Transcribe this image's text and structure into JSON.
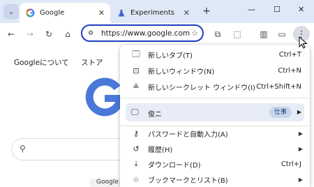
{
  "tabs": [
    {
      "title": "Google",
      "icon": "google-icon",
      "active": true
    },
    {
      "title": "Experiments",
      "icon": "flask-icon",
      "active": false
    }
  ],
  "toolbar": {
    "url": "https://www.google.com"
  },
  "page": {
    "links": [
      "Googleについて",
      "ストア"
    ],
    "button_partial": "Google"
  },
  "menu": {
    "items": [
      {
        "label": "新しいタブ(T)",
        "shortcut": "Ctrl+T",
        "icon": "new-tab-icon"
      },
      {
        "label": "新しいウィンドウ(N)",
        "shortcut": "Ctrl+N",
        "icon": "new-window-icon"
      },
      {
        "label": "新しいシークレット ウィンドウ(I)",
        "shortcut": "Ctrl+Shift+N",
        "icon": "incognito-icon"
      }
    ],
    "profile": {
      "label": "俊ニ",
      "badge": "仕事",
      "icon": "profile-icon"
    },
    "items2": [
      {
        "label": "パスワードと自動入力(A)",
        "icon": "key-icon"
      },
      {
        "label": "履歴(H)",
        "icon": "history-icon"
      },
      {
        "label": "ダウンロード(D)",
        "shortcut": "Ctrl+J",
        "icon": "download-icon"
      },
      {
        "label": "ブックマークとリスト(B)",
        "icon": "bookmark-star-icon"
      }
    ]
  },
  "colors": {
    "accent": "#1f3fbf",
    "titlebar": "#dfe8f6",
    "highlight": "#e7ecf6"
  }
}
